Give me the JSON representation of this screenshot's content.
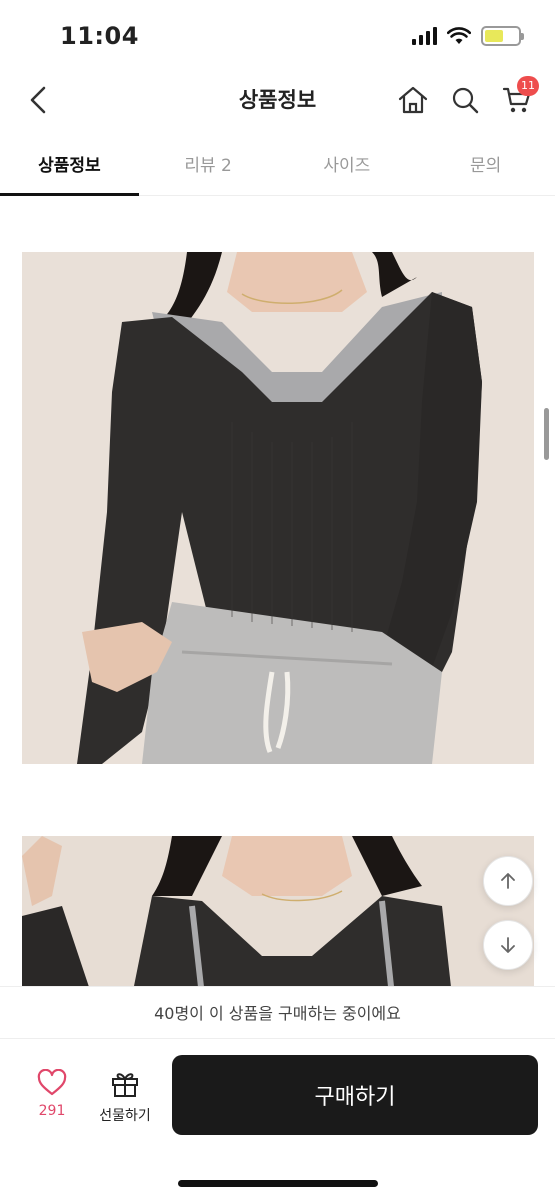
{
  "status": {
    "time": "11:04"
  },
  "header": {
    "title": "상품정보",
    "cart_count": "11"
  },
  "tabs": [
    {
      "label": "상품정보"
    },
    {
      "label": "리뷰 2"
    },
    {
      "label": "사이즈"
    },
    {
      "label": "문의"
    }
  ],
  "bottom": {
    "buying_notice": "40명이 이 상품을 구매하는 중이에요",
    "like_count": "291",
    "gift_label": "선물하기",
    "buy_label": "구매하기"
  },
  "colors": {
    "accent": "#e0476a",
    "badge": "#ee4d4d",
    "buy_button": "#1a1a1a"
  }
}
